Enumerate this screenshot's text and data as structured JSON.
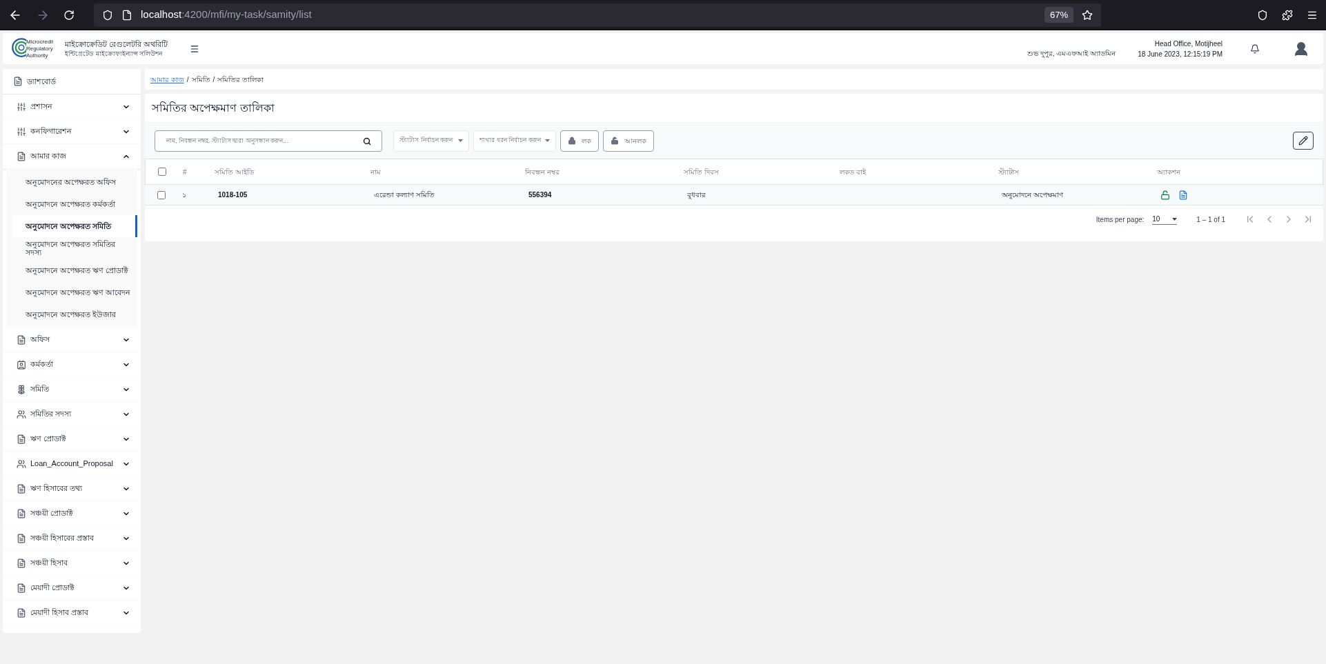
{
  "browser": {
    "url_host": "localhost",
    "url_path": ":4200/mfi/my-task/samity/list",
    "zoom": "67%"
  },
  "header": {
    "logo_text": [
      "Microcredit",
      "Regulatory",
      "Authority"
    ],
    "title": "মাইক্রোক্রেডিট রেগুলেটরি অথরিটি",
    "subtitle": "ইন্টিগ্রেটেড মাইক্রোফাইন্যান্স সলিউশন",
    "greeting": "শুভ দুপুর, এমএফআই অ্যাডমিন",
    "office": "Head Office, Motijheel",
    "datetime": "18 June 2023, 12:15:19 PM"
  },
  "sidebar": {
    "dashboard": "ড্যাশবোর্ড",
    "groups": [
      {
        "label": "প্রশাসন",
        "expanded": false
      },
      {
        "label": "কনফিগারেশন",
        "expanded": false
      },
      {
        "label": "আমার কাজ",
        "expanded": true,
        "children": [
          {
            "label": "অনুমোদনের অপেক্ষরত অফিস",
            "selected": false
          },
          {
            "label": "অনুমোদনে অপেক্ষরত কর্মকর্তা",
            "selected": false
          },
          {
            "label": "অনুমোদনে অপেক্ষরত সমিতি",
            "selected": true
          },
          {
            "label": "অনুমোদনে অপেক্ষরত সমিতির সদস্য",
            "selected": false
          },
          {
            "label": "অনুমোদনে অপেক্ষরত ঋণ প্রোডাক্ট",
            "selected": false
          },
          {
            "label": "অনুমোদনে অপেক্ষরত ঋণ আবেদন",
            "selected": false
          },
          {
            "label": "অনুমোদনে অপেক্ষরত ইউজার",
            "selected": false
          }
        ]
      },
      {
        "label": "অফিস",
        "expanded": false
      },
      {
        "label": "কর্মকর্তা",
        "expanded": false
      },
      {
        "label": "সমিতি",
        "expanded": false
      },
      {
        "label": "সমিতির সদস্য",
        "expanded": false
      },
      {
        "label": "ঋণ প্রোডাক্ট",
        "expanded": false
      },
      {
        "label": "Loan_Account_Proposal",
        "expanded": false
      },
      {
        "label": "ঋণ হিসাবের তথ্য",
        "expanded": false
      },
      {
        "label": "সঞ্চয়ী প্রোডাক্ট",
        "expanded": false
      },
      {
        "label": "সঞ্চয়ী হিসাবের প্রস্তাব",
        "expanded": false
      },
      {
        "label": "সঞ্চয়ী হিসাব",
        "expanded": false
      },
      {
        "label": "মেয়াদী প্রোডাক্ট",
        "expanded": false
      },
      {
        "label": "মেয়াদী হিসাব প্রস্তাব",
        "expanded": false
      }
    ]
  },
  "breadcrumb": {
    "separator": "/",
    "items": [
      "আমার কাজ",
      "সমিতি",
      "সমিতির তালিকা"
    ]
  },
  "page_title": "সমিতির অপেক্ষমাণ তালিকা",
  "toolbar": {
    "search": {
      "placeholder": "নাম, নিবন্ধন নম্বর, স্ট্যাটাস দ্বারা অনুসন্ধান করুন..."
    },
    "status_select": {
      "placeholder": "স্ট্যাটাস নির্বাচন করুন"
    },
    "branch_select": {
      "placeholder": "শাখার ধরন নির্বাচন করুন"
    },
    "lock_button": "লক",
    "unlock_button": "আনলক"
  },
  "table": {
    "all_checked": false,
    "columns": [
      "#",
      "সমিতি আইডি",
      "নাম",
      "নিবন্ধন নম্বর",
      "সমিতি দিবস",
      "লকড বাই",
      "স্ট্যাটাস",
      "অ্যাকশন"
    ],
    "rows": [
      {
        "checked": false,
        "cells": [
          "১",
          "1018-105",
          "এরেন্ডা কল্যাণ সমিতি",
          "556394",
          "বুধবার",
          "",
          "অনুমোদনে অপেক্ষমাণ"
        ]
      }
    ]
  },
  "paginator": {
    "label": "Items per page:",
    "page_size": "10",
    "range": "1 – 1 of 1"
  }
}
